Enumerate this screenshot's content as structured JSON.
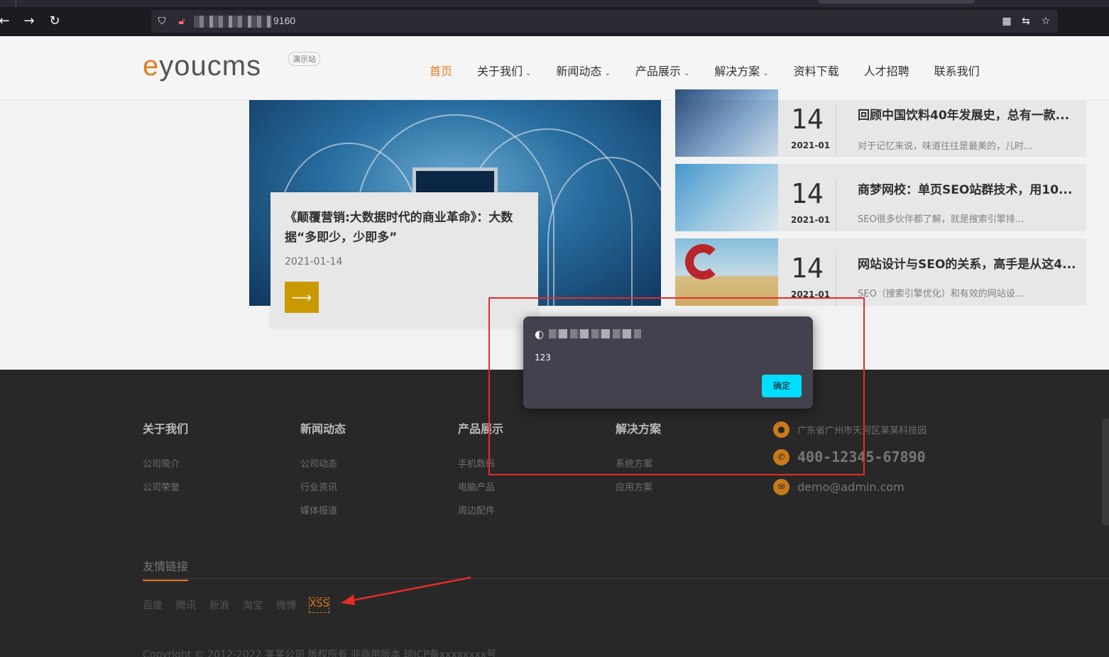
{
  "browser": {
    "url_suffix": "9160",
    "back_label": "←",
    "forward_label": "→",
    "reload_label": "↻"
  },
  "header": {
    "logo_e": "e",
    "logo_rest": "youcms",
    "demo_badge": "演示站",
    "nav": [
      {
        "label": "首页",
        "caret": ""
      },
      {
        "label": "关于我们",
        "caret": "⌄"
      },
      {
        "label": "新闻动态",
        "caret": "⌄"
      },
      {
        "label": "产品展示",
        "caret": "⌄"
      },
      {
        "label": "解决方案",
        "caret": "⌄"
      },
      {
        "label": "资料下载",
        "caret": ""
      },
      {
        "label": "人才招聘",
        "caret": ""
      },
      {
        "label": "联系我们",
        "caret": ""
      }
    ]
  },
  "featured": {
    "title": "《颠覆营销:大数据时代的商业革命》：大数据“多即少，少即多”",
    "date": "2021-01-14",
    "arrow": "⟶"
  },
  "side_news": [
    {
      "day": "14",
      "ym": "2021-01",
      "title": "回顾中国饮料40年发展史，总有一款...",
      "desc": "对于记忆来说，味道往往是最美的，儿时..."
    },
    {
      "day": "14",
      "ym": "2021-01",
      "title": "商梦网校：单页SEO站群技术，用10...",
      "desc": "SEO很多伙伴都了解，就是搜索引擎排..."
    },
    {
      "day": "14",
      "ym": "2021-01",
      "title": "网站设计与SEO的关系，高手是从这4...",
      "desc": "SEO（搜索引擎优化）和有效的网站设..."
    }
  ],
  "footer": {
    "columns": [
      {
        "title": "关于我们",
        "links": [
          "公司简介",
          "公司荣誉"
        ]
      },
      {
        "title": "新闻动态",
        "links": [
          "公司动态",
          "行业资讯",
          "媒体报道"
        ]
      },
      {
        "title": "产品展示",
        "links": [
          "手机数码",
          "电脑产品",
          "周边配件"
        ]
      },
      {
        "title": "解决方案",
        "links": [
          "系统方案",
          "应用方案"
        ]
      }
    ],
    "address": "广东省广州市天河区某某科技园",
    "phone": "400-12345-67890",
    "email": "demo@admin.com",
    "friend_title": "友情链接",
    "friend_links": [
      "百度",
      "腾讯",
      "新浪",
      "淘宝",
      "微博",
      "XSS"
    ],
    "copyright": "Copyright © 2012-2022 某某公司 版权所有 非商用版本    琼ICP备xxxxxxxx号"
  },
  "dialog": {
    "message": "123",
    "ok_label": "确定"
  },
  "colors": {
    "accent": "#e37a1f",
    "dialog_button": "#00ddff",
    "annotation": "#e52b2b"
  }
}
